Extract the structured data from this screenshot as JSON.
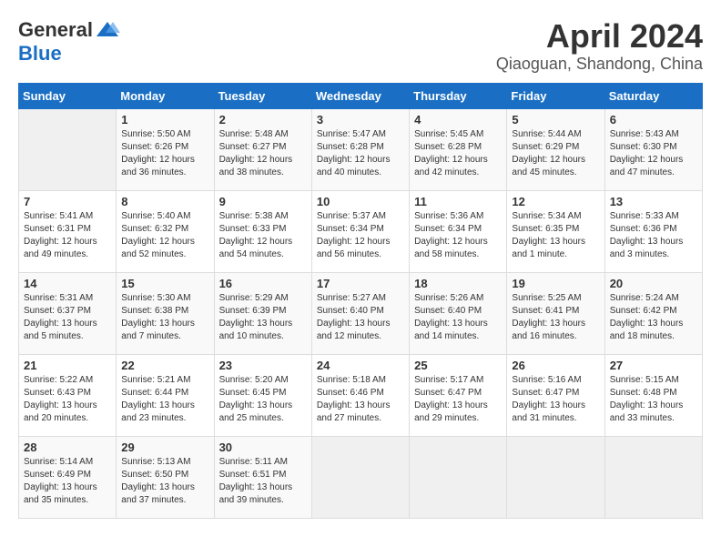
{
  "header": {
    "logo_general": "General",
    "logo_blue": "Blue",
    "month_year": "April 2024",
    "location": "Qiaoguan, Shandong, China"
  },
  "weekdays": [
    "Sunday",
    "Monday",
    "Tuesday",
    "Wednesday",
    "Thursday",
    "Friday",
    "Saturday"
  ],
  "weeks": [
    [
      {
        "day": "",
        "info": ""
      },
      {
        "day": "1",
        "info": "Sunrise: 5:50 AM\nSunset: 6:26 PM\nDaylight: 12 hours\nand 36 minutes."
      },
      {
        "day": "2",
        "info": "Sunrise: 5:48 AM\nSunset: 6:27 PM\nDaylight: 12 hours\nand 38 minutes."
      },
      {
        "day": "3",
        "info": "Sunrise: 5:47 AM\nSunset: 6:28 PM\nDaylight: 12 hours\nand 40 minutes."
      },
      {
        "day": "4",
        "info": "Sunrise: 5:45 AM\nSunset: 6:28 PM\nDaylight: 12 hours\nand 42 minutes."
      },
      {
        "day": "5",
        "info": "Sunrise: 5:44 AM\nSunset: 6:29 PM\nDaylight: 12 hours\nand 45 minutes."
      },
      {
        "day": "6",
        "info": "Sunrise: 5:43 AM\nSunset: 6:30 PM\nDaylight: 12 hours\nand 47 minutes."
      }
    ],
    [
      {
        "day": "7",
        "info": "Sunrise: 5:41 AM\nSunset: 6:31 PM\nDaylight: 12 hours\nand 49 minutes."
      },
      {
        "day": "8",
        "info": "Sunrise: 5:40 AM\nSunset: 6:32 PM\nDaylight: 12 hours\nand 52 minutes."
      },
      {
        "day": "9",
        "info": "Sunrise: 5:38 AM\nSunset: 6:33 PM\nDaylight: 12 hours\nand 54 minutes."
      },
      {
        "day": "10",
        "info": "Sunrise: 5:37 AM\nSunset: 6:34 PM\nDaylight: 12 hours\nand 56 minutes."
      },
      {
        "day": "11",
        "info": "Sunrise: 5:36 AM\nSunset: 6:34 PM\nDaylight: 12 hours\nand 58 minutes."
      },
      {
        "day": "12",
        "info": "Sunrise: 5:34 AM\nSunset: 6:35 PM\nDaylight: 13 hours\nand 1 minute."
      },
      {
        "day": "13",
        "info": "Sunrise: 5:33 AM\nSunset: 6:36 PM\nDaylight: 13 hours\nand 3 minutes."
      }
    ],
    [
      {
        "day": "14",
        "info": "Sunrise: 5:31 AM\nSunset: 6:37 PM\nDaylight: 13 hours\nand 5 minutes."
      },
      {
        "day": "15",
        "info": "Sunrise: 5:30 AM\nSunset: 6:38 PM\nDaylight: 13 hours\nand 7 minutes."
      },
      {
        "day": "16",
        "info": "Sunrise: 5:29 AM\nSunset: 6:39 PM\nDaylight: 13 hours\nand 10 minutes."
      },
      {
        "day": "17",
        "info": "Sunrise: 5:27 AM\nSunset: 6:40 PM\nDaylight: 13 hours\nand 12 minutes."
      },
      {
        "day": "18",
        "info": "Sunrise: 5:26 AM\nSunset: 6:40 PM\nDaylight: 13 hours\nand 14 minutes."
      },
      {
        "day": "19",
        "info": "Sunrise: 5:25 AM\nSunset: 6:41 PM\nDaylight: 13 hours\nand 16 minutes."
      },
      {
        "day": "20",
        "info": "Sunrise: 5:24 AM\nSunset: 6:42 PM\nDaylight: 13 hours\nand 18 minutes."
      }
    ],
    [
      {
        "day": "21",
        "info": "Sunrise: 5:22 AM\nSunset: 6:43 PM\nDaylight: 13 hours\nand 20 minutes."
      },
      {
        "day": "22",
        "info": "Sunrise: 5:21 AM\nSunset: 6:44 PM\nDaylight: 13 hours\nand 23 minutes."
      },
      {
        "day": "23",
        "info": "Sunrise: 5:20 AM\nSunset: 6:45 PM\nDaylight: 13 hours\nand 25 minutes."
      },
      {
        "day": "24",
        "info": "Sunrise: 5:18 AM\nSunset: 6:46 PM\nDaylight: 13 hours\nand 27 minutes."
      },
      {
        "day": "25",
        "info": "Sunrise: 5:17 AM\nSunset: 6:47 PM\nDaylight: 13 hours\nand 29 minutes."
      },
      {
        "day": "26",
        "info": "Sunrise: 5:16 AM\nSunset: 6:47 PM\nDaylight: 13 hours\nand 31 minutes."
      },
      {
        "day": "27",
        "info": "Sunrise: 5:15 AM\nSunset: 6:48 PM\nDaylight: 13 hours\nand 33 minutes."
      }
    ],
    [
      {
        "day": "28",
        "info": "Sunrise: 5:14 AM\nSunset: 6:49 PM\nDaylight: 13 hours\nand 35 minutes."
      },
      {
        "day": "29",
        "info": "Sunrise: 5:13 AM\nSunset: 6:50 PM\nDaylight: 13 hours\nand 37 minutes."
      },
      {
        "day": "30",
        "info": "Sunrise: 5:11 AM\nSunset: 6:51 PM\nDaylight: 13 hours\nand 39 minutes."
      },
      {
        "day": "",
        "info": ""
      },
      {
        "day": "",
        "info": ""
      },
      {
        "day": "",
        "info": ""
      },
      {
        "day": "",
        "info": ""
      }
    ]
  ]
}
